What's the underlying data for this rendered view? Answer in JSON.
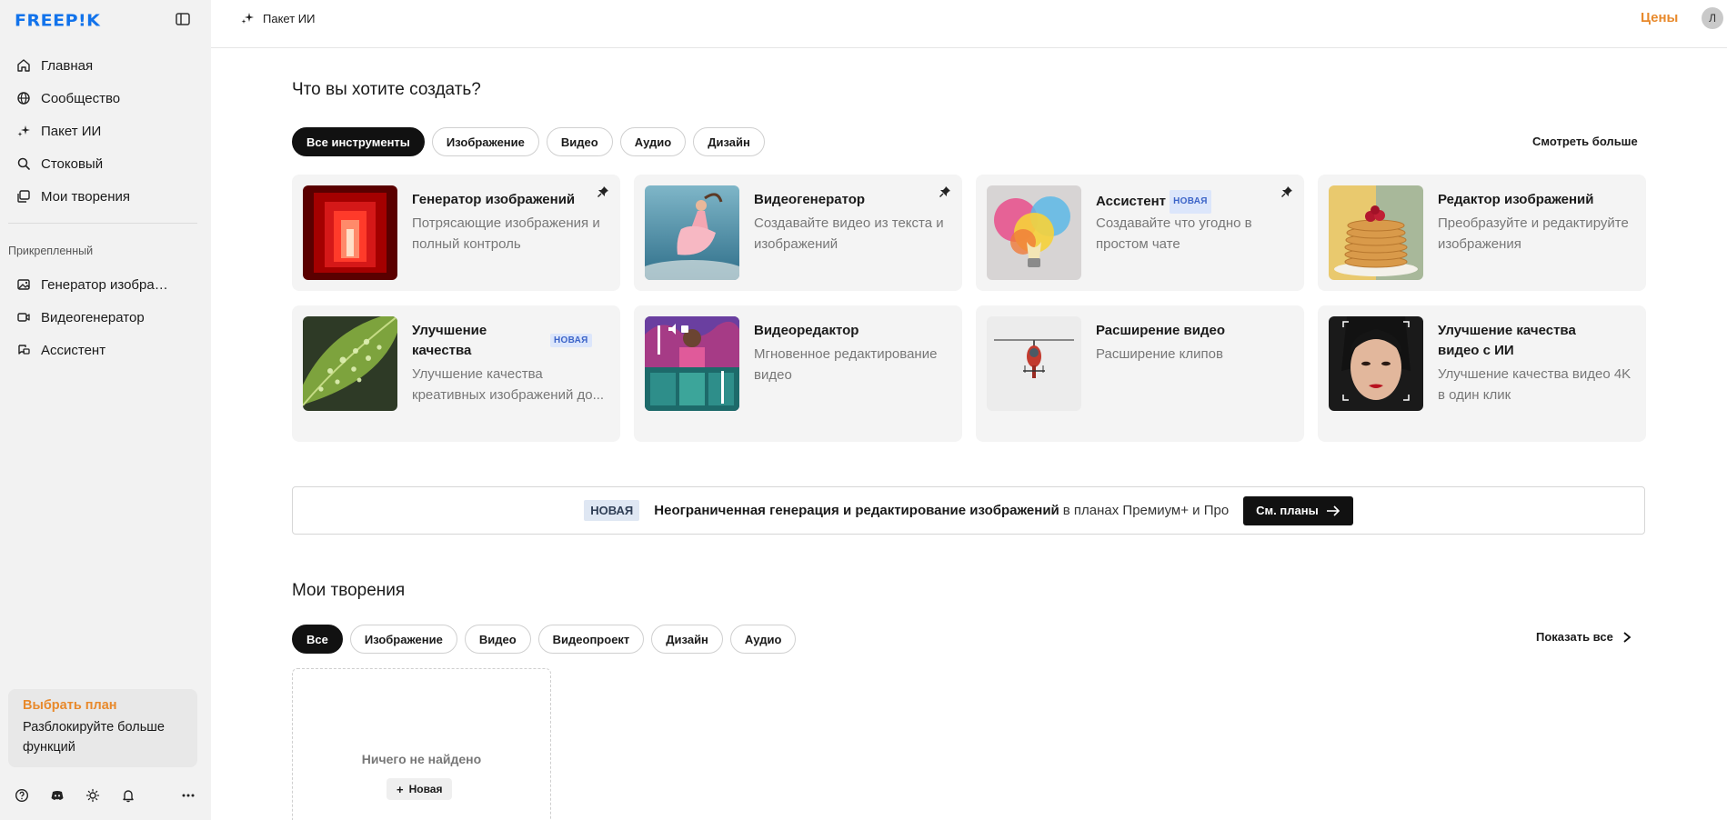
{
  "sidebar": {
    "logo": "FREEP!K",
    "nav": [
      {
        "label": "Главная",
        "icon": "home-icon"
      },
      {
        "label": "Сообщество",
        "icon": "globe-icon"
      },
      {
        "label": "Пакет ИИ",
        "icon": "sparkles-icon"
      },
      {
        "label": "Стоковый",
        "icon": "search-icon"
      },
      {
        "label": "Мои творения",
        "icon": "gallery-icon"
      }
    ],
    "pinned_title": "Прикрепленный",
    "pinned": [
      {
        "label": "Генератор изображений",
        "icon": "image-icon"
      },
      {
        "label": "Видеогенератор",
        "icon": "video-icon"
      },
      {
        "label": "Ассистент",
        "icon": "chat-icon"
      }
    ],
    "plan": {
      "title": "Выбрать план",
      "subtitle": "Разблокируйте больше функций"
    },
    "bottom_icons": [
      "help-icon",
      "discord-icon",
      "sun-icon",
      "bell-icon",
      "more-icon"
    ]
  },
  "topbar": {
    "breadcrumb": "Пакет ИИ",
    "prices": "Цены",
    "avatar": "Л"
  },
  "create": {
    "heading": "Что вы хотите создать?",
    "chips": [
      "Все инструменты",
      "Изображение",
      "Видео",
      "Аудио",
      "Дизайн"
    ],
    "see_more": "Смотреть больше",
    "cards": [
      {
        "title": "Генератор изображений",
        "desc": "Потрясающие изображения и полный контроль",
        "pinned": true
      },
      {
        "title": "Видеогенератор",
        "desc": "Создавайте видео из текста и изображений",
        "pinned": true
      },
      {
        "title": "Ассистент",
        "badge": "НОВАЯ",
        "desc": "Создавайте что угодно в простом чате",
        "pinned": true
      },
      {
        "title": "Редактор изображений",
        "desc": "Преобразуйте и редактируйте изображения"
      },
      {
        "title": "Улучшение качества",
        "badge": "НОВАЯ",
        "desc": "Улучшение качества креативных изображений до..."
      },
      {
        "title": "Видеоредактор",
        "desc": "Мгновенное редактирование видео"
      },
      {
        "title": "Расширение видео",
        "desc": "Расширение клипов"
      },
      {
        "title": "Улучшение качества видео с ИИ",
        "desc": "Улучшение качества видео 4K в один клик"
      }
    ]
  },
  "banner": {
    "badge": "НОВАЯ",
    "bold": "Неограниченная генерация и редактирование изображений",
    "rest": "в планах Премиум+ и Про",
    "cta": "См. планы"
  },
  "creations": {
    "heading": "Мои творения",
    "chips": [
      "Все",
      "Изображение",
      "Видео",
      "Видеопроект",
      "Дизайн",
      "Аудио"
    ],
    "show_all": "Показать все",
    "empty": "Ничего не найдено",
    "new_button": "Новая"
  },
  "colors": {
    "accent": "#e8892b",
    "brand": "#1273eb",
    "badge_bg": "#dce6fb"
  }
}
